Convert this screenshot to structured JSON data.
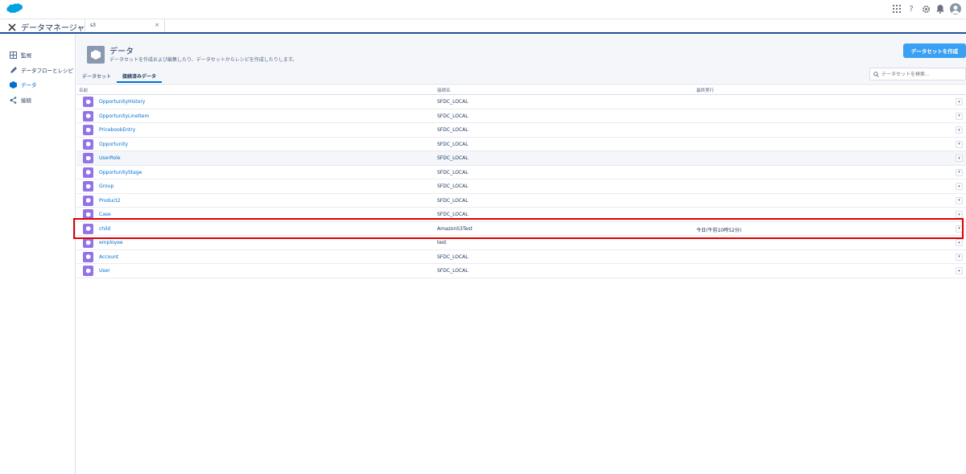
{
  "global_header": {
    "icons": [
      "salesforce-cloud-logo",
      "app-launcher-grid-icon",
      "help-icon",
      "setup-gear-icon",
      "notifications-bell-icon",
      "user-avatar"
    ],
    "help_glyph": "?"
  },
  "app_bar": {
    "title": "データマネージャ",
    "tab_label": "s3",
    "tab_close": "×"
  },
  "sidebar": {
    "items": [
      {
        "label": "監視",
        "icon": "monitor-icon"
      },
      {
        "label": "データフローとレシピ",
        "icon": "pencil-icon"
      },
      {
        "label": "データ",
        "icon": "data-hex-icon",
        "active": true
      },
      {
        "label": "接続",
        "icon": "connect-icon"
      }
    ]
  },
  "page": {
    "title": "データ",
    "description": "データセットを作成および編集したり、データセットからレシピを作成したりします。",
    "create_button": "データセットを作成",
    "tabs": [
      {
        "label": "データセット",
        "active": false
      },
      {
        "label": "接続済みデータ",
        "active": true
      }
    ],
    "search_placeholder": "データセットを検索..."
  },
  "table": {
    "columns": [
      "名前",
      "接続名",
      "最終実行"
    ],
    "rows": [
      {
        "name": "OpportunityHistory",
        "connection": "SFDC_LOCAL",
        "last_run": ""
      },
      {
        "name": "OpportunityLineItem",
        "connection": "SFDC_LOCAL",
        "last_run": ""
      },
      {
        "name": "PricebookEntry",
        "connection": "SFDC_LOCAL",
        "last_run": ""
      },
      {
        "name": "Opportunity",
        "connection": "SFDC_LOCAL",
        "last_run": ""
      },
      {
        "name": "UserRole",
        "connection": "SFDC_LOCAL",
        "last_run": ""
      },
      {
        "name": "OpportunityStage",
        "connection": "SFDC_LOCAL",
        "last_run": ""
      },
      {
        "name": "Group",
        "connection": "SFDC_LOCAL",
        "last_run": ""
      },
      {
        "name": "Product2",
        "connection": "SFDC_LOCAL",
        "last_run": ""
      },
      {
        "name": "Case",
        "connection": "SFDC_LOCAL",
        "last_run": ""
      },
      {
        "name": "child",
        "connection": "AmazonS3Test",
        "last_run": "今日(午前10時52分)"
      },
      {
        "name": "employee",
        "connection": "test",
        "last_run": ""
      },
      {
        "name": "Account",
        "connection": "SFDC_LOCAL",
        "last_run": ""
      },
      {
        "name": "User",
        "connection": "SFDC_LOCAL",
        "last_run": ""
      }
    ],
    "row_menu_glyph": "▾"
  },
  "colors": {
    "brand_blue": "#0070d2",
    "button_blue": "#3aa0f4",
    "dataset_purple": "#9274e5",
    "highlight_red": "#e00000"
  }
}
